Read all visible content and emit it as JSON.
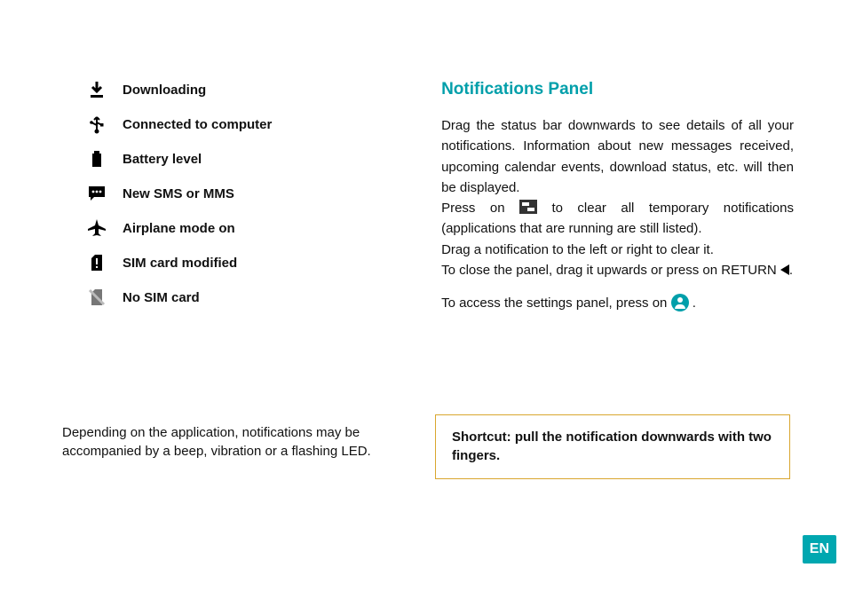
{
  "icons": {
    "downloading": "Downloading",
    "usb": "Connected to computer",
    "battery": "Battery level",
    "sms": "New SMS or MMS",
    "airplane": "Airplane mode on",
    "sim_mod": "SIM card modified",
    "no_sim": "No SIM card"
  },
  "left_footer": "Depending on the application, notifications may be accompanied by a beep, vibration or a flashing LED.",
  "panel": {
    "title": "Notifications Panel",
    "p1": "Drag the status bar downwards to see details of all your notifications. Information about new messages received, upcoming calendar events, download status, etc. will then be displayed.",
    "p2a": "Press on ",
    "p2b": " to clear all temporary notifications (applications that are running are still listed).",
    "p3": "Drag a notification to the left or right to clear it.",
    "p4a": "To close the panel, drag it upwards or press on RETURN ",
    "p4b": ".",
    "p5a": "To access the settings panel, press on ",
    "p5b": "."
  },
  "shortcut": "Shortcut: pull the notification downwards with two fingers.",
  "lang": "EN"
}
